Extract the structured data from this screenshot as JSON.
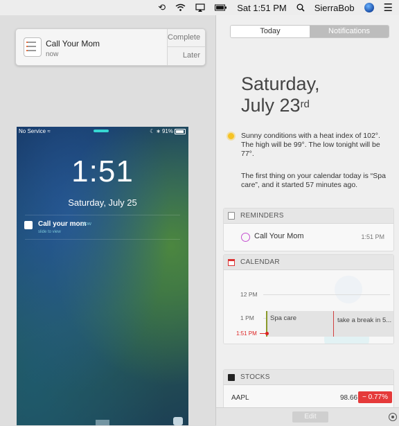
{
  "menubar": {
    "clock": "Sat 1:51 PM",
    "user": "SierraBob",
    "icons": [
      "time-machine-icon",
      "wifi-icon",
      "airplay-icon",
      "battery-icon",
      "search-icon",
      "siri-icon",
      "notification-center-icon"
    ]
  },
  "banner": {
    "title": "Call Your Mom",
    "time": "now",
    "complete_label": "Complete",
    "later_label": "Later"
  },
  "phone": {
    "carrier": "No Service",
    "battery": "91%",
    "time": "1:51",
    "date": "Saturday, July 25",
    "notification": {
      "title": "Call your mom",
      "time": "now",
      "subtitle": "slide to view"
    }
  },
  "nc": {
    "tabs": [
      {
        "label": "Today",
        "active": true
      },
      {
        "label": "Notifications",
        "active": false
      }
    ],
    "day": "Saturday,",
    "date_main": "July 23",
    "date_suffix": "rd",
    "weather": "Sunny conditions with a heat index of 102°. The high will be 99°. The low tonight will be 77°.",
    "calendar_summary": "The first thing on your calendar today is “Spa care”, and it started 57 minutes ago.",
    "reminders": {
      "header": "REMINDERS",
      "items": [
        {
          "title": "Call Your Mom",
          "time": "1:51 PM"
        }
      ]
    },
    "calendar": {
      "header": "CALENDAR",
      "hours": [
        "12 PM",
        "1 PM"
      ],
      "now_label": "1:51 PM",
      "events": [
        "Spa care",
        "take a break in 5..."
      ]
    },
    "stocks": {
      "header": "STOCKS",
      "items": [
        {
          "symbol": "AAPL",
          "price": "98.66",
          "change": "− 0.77%"
        }
      ]
    },
    "edit_label": "Edit"
  },
  "colors": {
    "accent": "#c44fd0",
    "stock_down": "#e53a3a",
    "now_line": "#dd2222"
  }
}
